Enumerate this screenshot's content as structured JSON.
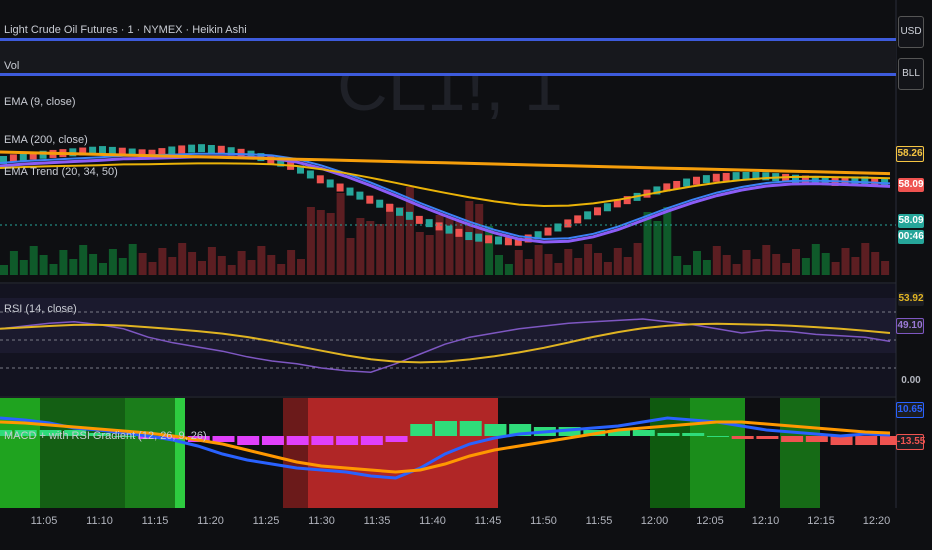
{
  "watermark": "CL1!, 1",
  "legends": {
    "symbol": "Light Crude Oil Futures · 1 · NYMEX · Heikin Ashi",
    "vol": "Vol",
    "ema9": "EMA (9, close)",
    "ema200": "EMA (200, close)",
    "emaribbon": "EMA Trend (20, 34, 50)",
    "rsi": "RSI (14, close)",
    "macd": "MACD + with RSI Gradient (12, 26, 9, 26)"
  },
  "right_axis": {
    "usd": "USD",
    "bll": "BLL",
    "p1": "58.26",
    "p2": "58.09",
    "p3": "58.09",
    "countdown": "00:46",
    "rsi1": "53.92",
    "rsi2": "49.10",
    "zero": "0.00",
    "macd1": "10.65",
    "macd2": "-13.55"
  },
  "colors": {
    "up": "#26a69a",
    "down": "#ef5350",
    "ema_orange": "#f59e0b",
    "ema_yellow": "#eab308",
    "ema_purple": "#8b5cf6",
    "ema_blue": "#3b82f6",
    "rsi_line": "#7e57c2",
    "rsi_ma": "#e0b422",
    "macd_line": "#2962ff",
    "signal_line": "#ff9800"
  },
  "chart_data": {
    "type": "candlestick",
    "x_tick_labels": [
      "11:05",
      "11:10",
      "11:15",
      "11:20",
      "11:25",
      "11:30",
      "11:35",
      "11:40",
      "11:45",
      "11:50",
      "11:55",
      "12:00",
      "12:05",
      "12:10",
      "12:15",
      "12:20"
    ],
    "price_axis_labels": [
      "58.26",
      "58.09",
      "58.09"
    ],
    "rsi_axis_labels": [
      "53.92",
      "49.10"
    ],
    "macd_axis_labels": [
      "0.00",
      "10.65",
      "-13.55"
    ],
    "price_trend": [
      58.2,
      58.22,
      58.23,
      58.24,
      58.25,
      58.24,
      58.23,
      58.25,
      58.26,
      58.25,
      58.23,
      58.2,
      58.16,
      58.1,
      58.05,
      58.0,
      57.95,
      57.9,
      57.86,
      57.82,
      57.8,
      57.79,
      57.83,
      57.88,
      57.93,
      57.98,
      58.02,
      58.06,
      58.09,
      58.11,
      58.12,
      58.12,
      58.11,
      58.1,
      58.09,
      58.1,
      58.09
    ],
    "rsi": [
      58,
      60,
      62,
      63,
      61,
      58,
      52,
      48,
      45,
      42,
      38,
      35,
      33,
      30,
      28,
      27,
      33,
      40,
      47,
      52,
      55,
      58,
      60,
      62,
      63,
      64,
      65,
      63,
      61,
      58,
      55,
      57,
      56,
      54,
      53,
      52,
      49
    ],
    "macd_hist": [
      2,
      2,
      2,
      2,
      1,
      0,
      -1,
      -1,
      -2,
      -2,
      -3,
      -3,
      -3,
      -3,
      -3,
      -3,
      -2,
      4,
      5,
      5,
      4,
      4,
      3,
      3,
      2,
      2,
      2,
      1,
      1,
      0,
      -1,
      -1,
      -2,
      -2,
      -3,
      -3,
      -3
    ]
  }
}
